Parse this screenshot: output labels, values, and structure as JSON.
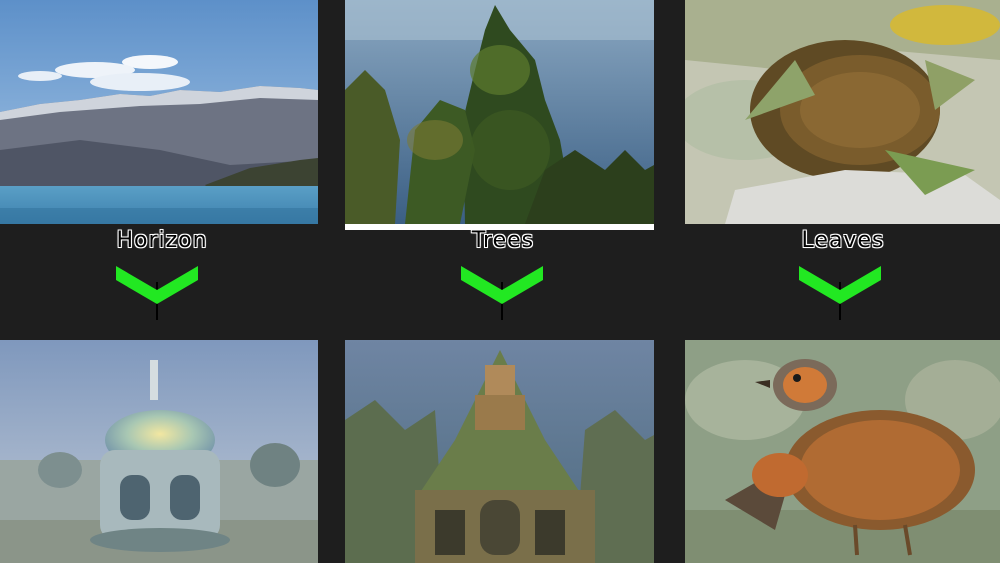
{
  "columns": [
    {
      "label": "Horizon",
      "arrow_color": "#22e822"
    },
    {
      "label": "Trees",
      "arrow_color": "#22e822"
    },
    {
      "label": "Leaves",
      "arrow_color": "#22e822"
    }
  ],
  "colors": {
    "background": "#1e1e1e",
    "arrow": "#22e822"
  }
}
